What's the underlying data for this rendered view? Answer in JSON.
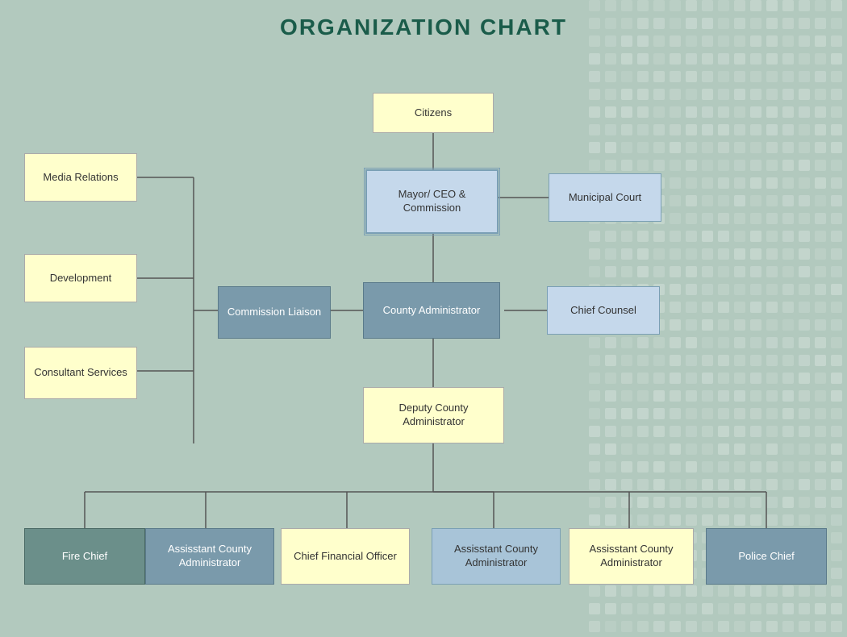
{
  "title": "ORGANIZATION CHART",
  "nodes": {
    "citizens": {
      "label": "Citizens"
    },
    "mayor": {
      "label": "Mayor/\nCEO & Commission"
    },
    "municipal_court": {
      "label": "Municipal Court"
    },
    "media_relations": {
      "label": "Media Relations"
    },
    "development": {
      "label": "Development"
    },
    "consultant_services": {
      "label": "Consultant\nServices"
    },
    "commission_liaison": {
      "label": "Commission\nLiaison"
    },
    "county_administrator": {
      "label": "County\nAdministrator"
    },
    "chief_counsel": {
      "label": "Chief Counsel"
    },
    "deputy_county_admin": {
      "label": "Deputy County\nAdministrator"
    },
    "fire_chief": {
      "label": "Fire Chief"
    },
    "asst_admin_1": {
      "label": "Assisstant County\nAdministrator"
    },
    "cfo": {
      "label": "Chief Financial\nOfficer"
    },
    "asst_admin_2": {
      "label": "Assisstant County\nAdministrator"
    },
    "asst_admin_3": {
      "label": "Assisstant County\nAdministrator"
    },
    "police_chief": {
      "label": "Police Chief"
    }
  }
}
